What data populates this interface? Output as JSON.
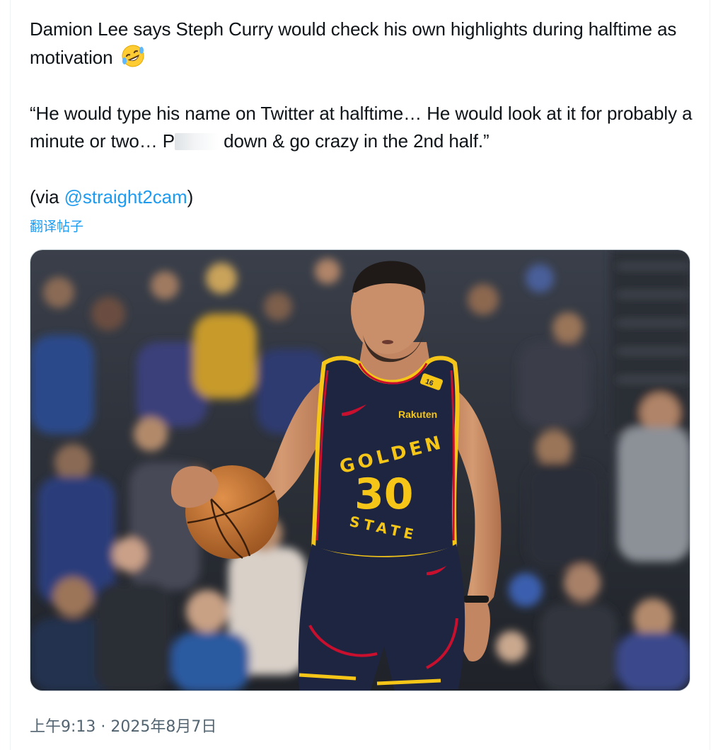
{
  "tweet": {
    "line1": "Damion Lee says Steph Curry would check his own highlights during halftime as motivation",
    "emoji": "rolling-on-the-floor-laughing",
    "quote_before": "“He would type his name on Twitter at halftime… He would look at it for probably a minute or two… P",
    "quote_after": " down & go crazy in the 2nd half.”",
    "via_prefix": "(via ",
    "mention": "@straight2cam",
    "via_suffix": ")",
    "translate_link": "翻译帖子"
  },
  "media": {
    "jersey_top": "GOLDEN",
    "jersey_bottom": "STATE",
    "jersey_number": "30",
    "sponsor": "Rakuten",
    "strap_number": "16"
  },
  "meta": {
    "timestamp": "上午9:13 · 2025年8月7日"
  },
  "colors": {
    "link": "#1d9bf0",
    "secondary_text": "#536471",
    "jersey_navy": "#1d2541",
    "jersey_gold": "#f5c518",
    "jersey_red": "#c8102e"
  }
}
